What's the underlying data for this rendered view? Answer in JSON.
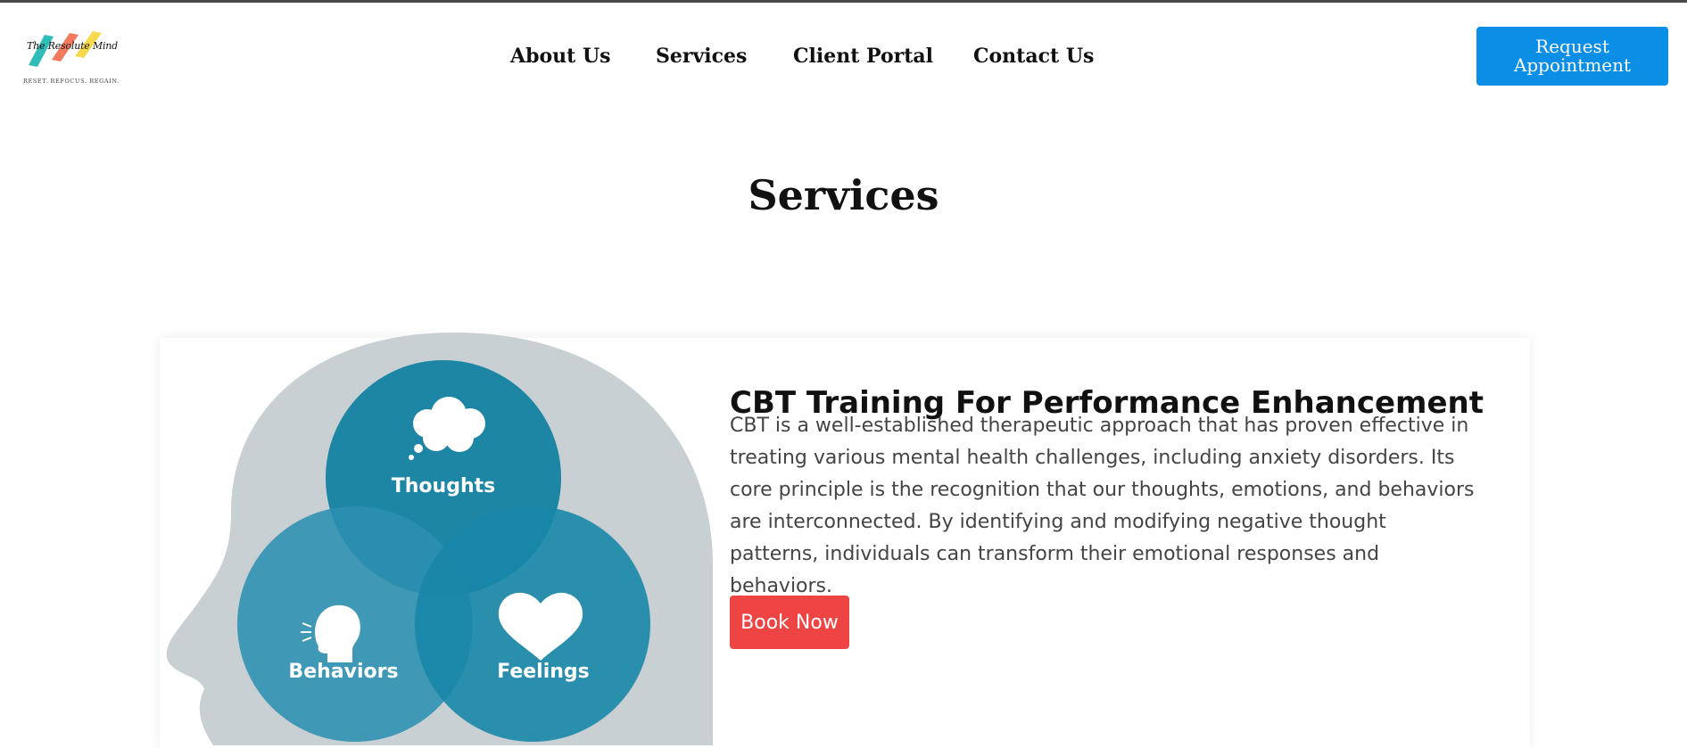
{
  "logo": {
    "name": "The Resolute Mind",
    "tagline": "RESET. REFOCUS. REGAIN.",
    "colors": [
      "#1ab5b0",
      "#f06d4a",
      "#f5d53a"
    ]
  },
  "nav": {
    "items": [
      {
        "label": "About Us"
      },
      {
        "label": "Services"
      },
      {
        "label": "Client Portal"
      },
      {
        "label": "Contact Us"
      }
    ],
    "cta_label": "Request Appointment"
  },
  "page": {
    "title": "Services"
  },
  "service": {
    "title": "CBT Training For Performance Enhancement",
    "description": "CBT is a well-established therapeutic approach that has proven effective in treating various mental health challenges, including anxiety disorders. Its core principle is the recognition that our thoughts, emotions, and behaviors are interconnected. By identifying and modifying negative thought patterns, individuals can transform their emotional responses and behaviors.",
    "button_label": "Book Now",
    "illustration": {
      "labels": {
        "thoughts": "Thoughts",
        "behaviors": "Behaviors",
        "feelings": "Feelings"
      }
    }
  },
  "colors": {
    "cta": "#0b8fe6",
    "book_button": "#ee4444",
    "circle_teal": "#0e7fa0",
    "head_gray": "#c8d0d3"
  }
}
